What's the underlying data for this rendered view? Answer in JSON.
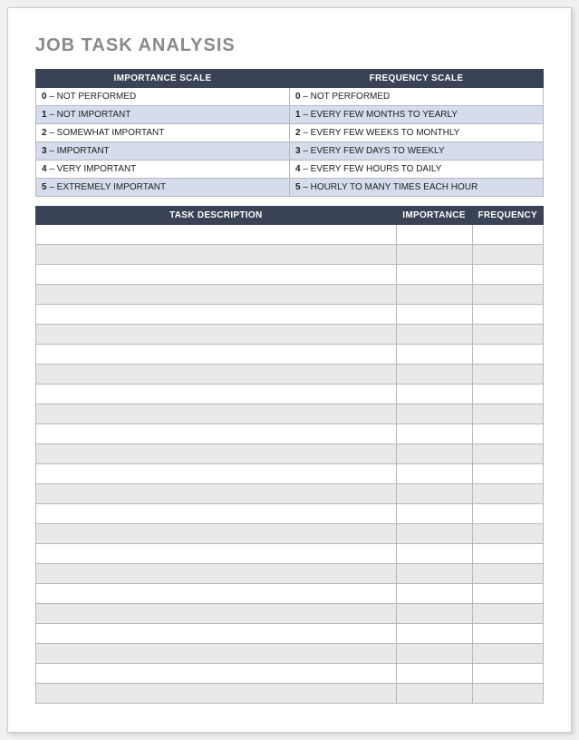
{
  "title": "JOB TASK ANALYSIS",
  "scales": {
    "importance_header": "IMPORTANCE SCALE",
    "frequency_header": "FREQUENCY SCALE",
    "rows": [
      {
        "imp_num": "0",
        "imp_label": " – NOT PERFORMED",
        "freq_num": "0",
        "freq_label": " – NOT PERFORMED"
      },
      {
        "imp_num": "1",
        "imp_label": " – NOT IMPORTANT",
        "freq_num": "1",
        "freq_label": " – EVERY FEW MONTHS TO YEARLY"
      },
      {
        "imp_num": "2",
        "imp_label": " – SOMEWHAT IMPORTANT",
        "freq_num": "2",
        "freq_label": " – EVERY FEW WEEKS TO MONTHLY"
      },
      {
        "imp_num": "3",
        "imp_label": " – IMPORTANT",
        "freq_num": "3",
        "freq_label": " – EVERY FEW DAYS TO WEEKLY"
      },
      {
        "imp_num": "4",
        "imp_label": " – VERY IMPORTANT",
        "freq_num": "4",
        "freq_label": " – EVERY FEW HOURS TO DAILY"
      },
      {
        "imp_num": "5",
        "imp_label": " – EXTREMELY IMPORTANT",
        "freq_num": "5",
        "freq_label": " – HOURLY TO MANY TIMES EACH HOUR"
      }
    ]
  },
  "task_headers": {
    "description": "TASK DESCRIPTION",
    "importance": "IMPORTANCE",
    "frequency": "FREQUENCY"
  },
  "task_rows": [
    {
      "description": "",
      "importance": "",
      "frequency": ""
    },
    {
      "description": "",
      "importance": "",
      "frequency": ""
    },
    {
      "description": "",
      "importance": "",
      "frequency": ""
    },
    {
      "description": "",
      "importance": "",
      "frequency": ""
    },
    {
      "description": "",
      "importance": "",
      "frequency": ""
    },
    {
      "description": "",
      "importance": "",
      "frequency": ""
    },
    {
      "description": "",
      "importance": "",
      "frequency": ""
    },
    {
      "description": "",
      "importance": "",
      "frequency": ""
    },
    {
      "description": "",
      "importance": "",
      "frequency": ""
    },
    {
      "description": "",
      "importance": "",
      "frequency": ""
    },
    {
      "description": "",
      "importance": "",
      "frequency": ""
    },
    {
      "description": "",
      "importance": "",
      "frequency": ""
    },
    {
      "description": "",
      "importance": "",
      "frequency": ""
    },
    {
      "description": "",
      "importance": "",
      "frequency": ""
    },
    {
      "description": "",
      "importance": "",
      "frequency": ""
    },
    {
      "description": "",
      "importance": "",
      "frequency": ""
    },
    {
      "description": "",
      "importance": "",
      "frequency": ""
    },
    {
      "description": "",
      "importance": "",
      "frequency": ""
    },
    {
      "description": "",
      "importance": "",
      "frequency": ""
    },
    {
      "description": "",
      "importance": "",
      "frequency": ""
    },
    {
      "description": "",
      "importance": "",
      "frequency": ""
    },
    {
      "description": "",
      "importance": "",
      "frequency": ""
    },
    {
      "description": "",
      "importance": "",
      "frequency": ""
    },
    {
      "description": "",
      "importance": "",
      "frequency": ""
    }
  ]
}
